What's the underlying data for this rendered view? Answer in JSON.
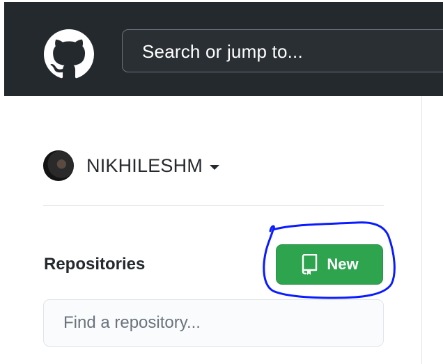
{
  "header": {
    "search_placeholder": "Search or jump to...",
    "logo_icon": "github-octocat-icon"
  },
  "account": {
    "username": "NIKHILESHM",
    "caret_icon": "caret-down-icon"
  },
  "repositories": {
    "title": "Repositories",
    "new_label": "New",
    "new_icon": "repo-icon",
    "find_placeholder": "Find a repository..."
  },
  "colors": {
    "header_bg": "#24292e",
    "primary_green": "#2ea44f",
    "annotation_blue": "#0a1cff"
  }
}
